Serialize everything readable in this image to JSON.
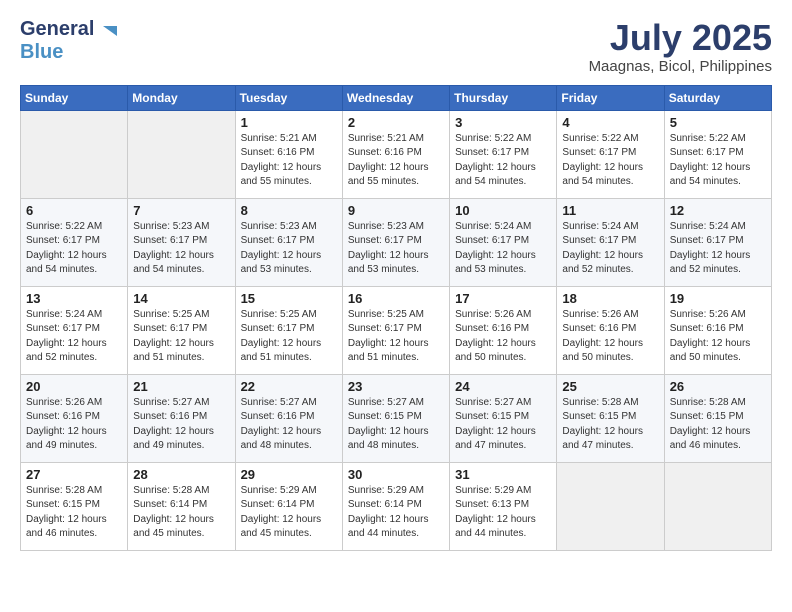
{
  "header": {
    "logo_line1": "General",
    "logo_line2": "Blue",
    "month": "July 2025",
    "location": "Maagnas, Bicol, Philippines"
  },
  "weekdays": [
    "Sunday",
    "Monday",
    "Tuesday",
    "Wednesday",
    "Thursday",
    "Friday",
    "Saturday"
  ],
  "rows": [
    [
      {
        "day": "",
        "info": ""
      },
      {
        "day": "",
        "info": ""
      },
      {
        "day": "1",
        "info": "Sunrise: 5:21 AM\nSunset: 6:16 PM\nDaylight: 12 hours\nand 55 minutes."
      },
      {
        "day": "2",
        "info": "Sunrise: 5:21 AM\nSunset: 6:16 PM\nDaylight: 12 hours\nand 55 minutes."
      },
      {
        "day": "3",
        "info": "Sunrise: 5:22 AM\nSunset: 6:17 PM\nDaylight: 12 hours\nand 54 minutes."
      },
      {
        "day": "4",
        "info": "Sunrise: 5:22 AM\nSunset: 6:17 PM\nDaylight: 12 hours\nand 54 minutes."
      },
      {
        "day": "5",
        "info": "Sunrise: 5:22 AM\nSunset: 6:17 PM\nDaylight: 12 hours\nand 54 minutes."
      }
    ],
    [
      {
        "day": "6",
        "info": "Sunrise: 5:22 AM\nSunset: 6:17 PM\nDaylight: 12 hours\nand 54 minutes."
      },
      {
        "day": "7",
        "info": "Sunrise: 5:23 AM\nSunset: 6:17 PM\nDaylight: 12 hours\nand 54 minutes."
      },
      {
        "day": "8",
        "info": "Sunrise: 5:23 AM\nSunset: 6:17 PM\nDaylight: 12 hours\nand 53 minutes."
      },
      {
        "day": "9",
        "info": "Sunrise: 5:23 AM\nSunset: 6:17 PM\nDaylight: 12 hours\nand 53 minutes."
      },
      {
        "day": "10",
        "info": "Sunrise: 5:24 AM\nSunset: 6:17 PM\nDaylight: 12 hours\nand 53 minutes."
      },
      {
        "day": "11",
        "info": "Sunrise: 5:24 AM\nSunset: 6:17 PM\nDaylight: 12 hours\nand 52 minutes."
      },
      {
        "day": "12",
        "info": "Sunrise: 5:24 AM\nSunset: 6:17 PM\nDaylight: 12 hours\nand 52 minutes."
      }
    ],
    [
      {
        "day": "13",
        "info": "Sunrise: 5:24 AM\nSunset: 6:17 PM\nDaylight: 12 hours\nand 52 minutes."
      },
      {
        "day": "14",
        "info": "Sunrise: 5:25 AM\nSunset: 6:17 PM\nDaylight: 12 hours\nand 51 minutes."
      },
      {
        "day": "15",
        "info": "Sunrise: 5:25 AM\nSunset: 6:17 PM\nDaylight: 12 hours\nand 51 minutes."
      },
      {
        "day": "16",
        "info": "Sunrise: 5:25 AM\nSunset: 6:17 PM\nDaylight: 12 hours\nand 51 minutes."
      },
      {
        "day": "17",
        "info": "Sunrise: 5:26 AM\nSunset: 6:16 PM\nDaylight: 12 hours\nand 50 minutes."
      },
      {
        "day": "18",
        "info": "Sunrise: 5:26 AM\nSunset: 6:16 PM\nDaylight: 12 hours\nand 50 minutes."
      },
      {
        "day": "19",
        "info": "Sunrise: 5:26 AM\nSunset: 6:16 PM\nDaylight: 12 hours\nand 50 minutes."
      }
    ],
    [
      {
        "day": "20",
        "info": "Sunrise: 5:26 AM\nSunset: 6:16 PM\nDaylight: 12 hours\nand 49 minutes."
      },
      {
        "day": "21",
        "info": "Sunrise: 5:27 AM\nSunset: 6:16 PM\nDaylight: 12 hours\nand 49 minutes."
      },
      {
        "day": "22",
        "info": "Sunrise: 5:27 AM\nSunset: 6:16 PM\nDaylight: 12 hours\nand 48 minutes."
      },
      {
        "day": "23",
        "info": "Sunrise: 5:27 AM\nSunset: 6:15 PM\nDaylight: 12 hours\nand 48 minutes."
      },
      {
        "day": "24",
        "info": "Sunrise: 5:27 AM\nSunset: 6:15 PM\nDaylight: 12 hours\nand 47 minutes."
      },
      {
        "day": "25",
        "info": "Sunrise: 5:28 AM\nSunset: 6:15 PM\nDaylight: 12 hours\nand 47 minutes."
      },
      {
        "day": "26",
        "info": "Sunrise: 5:28 AM\nSunset: 6:15 PM\nDaylight: 12 hours\nand 46 minutes."
      }
    ],
    [
      {
        "day": "27",
        "info": "Sunrise: 5:28 AM\nSunset: 6:15 PM\nDaylight: 12 hours\nand 46 minutes."
      },
      {
        "day": "28",
        "info": "Sunrise: 5:28 AM\nSunset: 6:14 PM\nDaylight: 12 hours\nand 45 minutes."
      },
      {
        "day": "29",
        "info": "Sunrise: 5:29 AM\nSunset: 6:14 PM\nDaylight: 12 hours\nand 45 minutes."
      },
      {
        "day": "30",
        "info": "Sunrise: 5:29 AM\nSunset: 6:14 PM\nDaylight: 12 hours\nand 44 minutes."
      },
      {
        "day": "31",
        "info": "Sunrise: 5:29 AM\nSunset: 6:13 PM\nDaylight: 12 hours\nand 44 minutes."
      },
      {
        "day": "",
        "info": ""
      },
      {
        "day": "",
        "info": ""
      }
    ]
  ]
}
